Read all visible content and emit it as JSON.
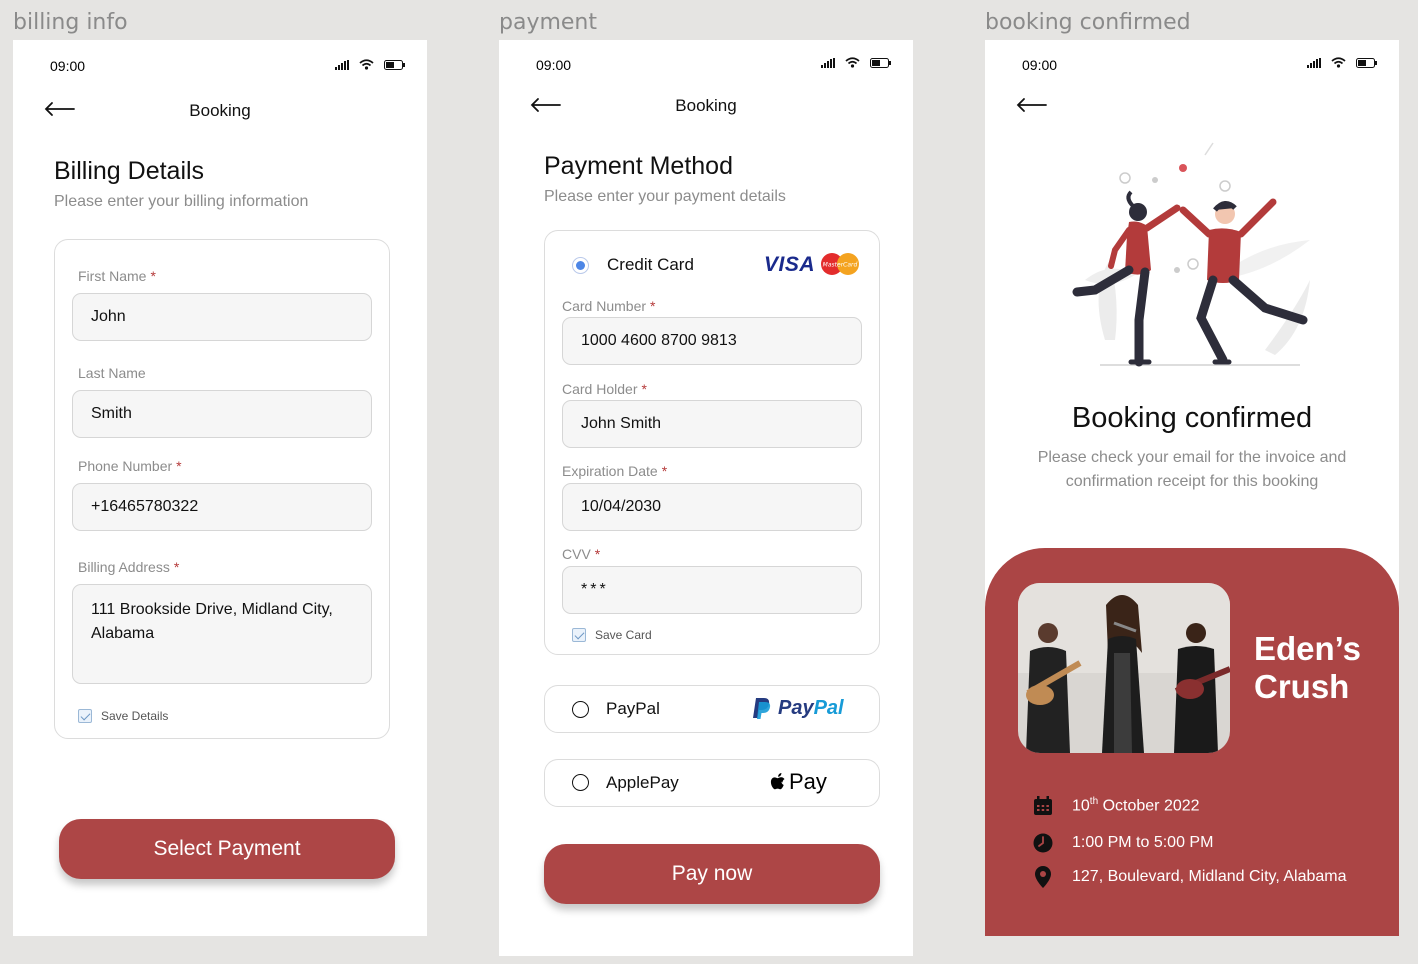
{
  "frames": {
    "billing": "billing info",
    "payment": "payment",
    "confirmed": "booking confirmed"
  },
  "status": {
    "time": "09:00"
  },
  "billing": {
    "top_title": "Booking",
    "title": "Billing Details",
    "subtitle": "Please enter your billing information",
    "first_name_label": "First Name",
    "first_name": "John",
    "last_name_label": "Last Name",
    "last_name": "Smith",
    "phone_label": "Phone Number",
    "phone": "+16465780322",
    "address_label": "Billing Address",
    "address": "111 Brookside Drive, Midland City, Alabama",
    "save_label": "Save Details",
    "button": "Select Payment",
    "required": "*"
  },
  "payment": {
    "top_title": "Booking",
    "title": "Payment Method",
    "subtitle": "Please enter your payment details",
    "credit_card": "Credit Card",
    "visa": "VISA",
    "mastercard": "MasterCard",
    "card_number_label": "Card Number",
    "card_number": "1000 4600 8700 9813",
    "card_holder_label": "Card Holder",
    "card_holder": "John Smith",
    "expiration_label": "Expiration Date",
    "expiration": "10/04/2030",
    "cvv_label": "CVV",
    "cvv": "***",
    "save_label": "Save Card",
    "paypal": "PayPal",
    "paypal_logo_a": "Pay",
    "paypal_logo_b": "Pal",
    "applepay": "ApplePay",
    "applepay_logo": "Pay",
    "button": "Pay now",
    "required": "*"
  },
  "confirmed": {
    "title": "Booking confirmed",
    "text": "Please check your email for the invoice and confirmation receipt for this booking",
    "band": "Eden’s Crush",
    "date_day": "10",
    "date_sup": "th",
    "date_rest": " October 2022",
    "time": "1:00 PM to 5:00 PM",
    "location": "127, Boulevard, Midland City, Alabama"
  },
  "colors": {
    "accent": "#ad4646",
    "radio_selected": "#4d86e6",
    "muted_text": "#8c8c8c"
  }
}
